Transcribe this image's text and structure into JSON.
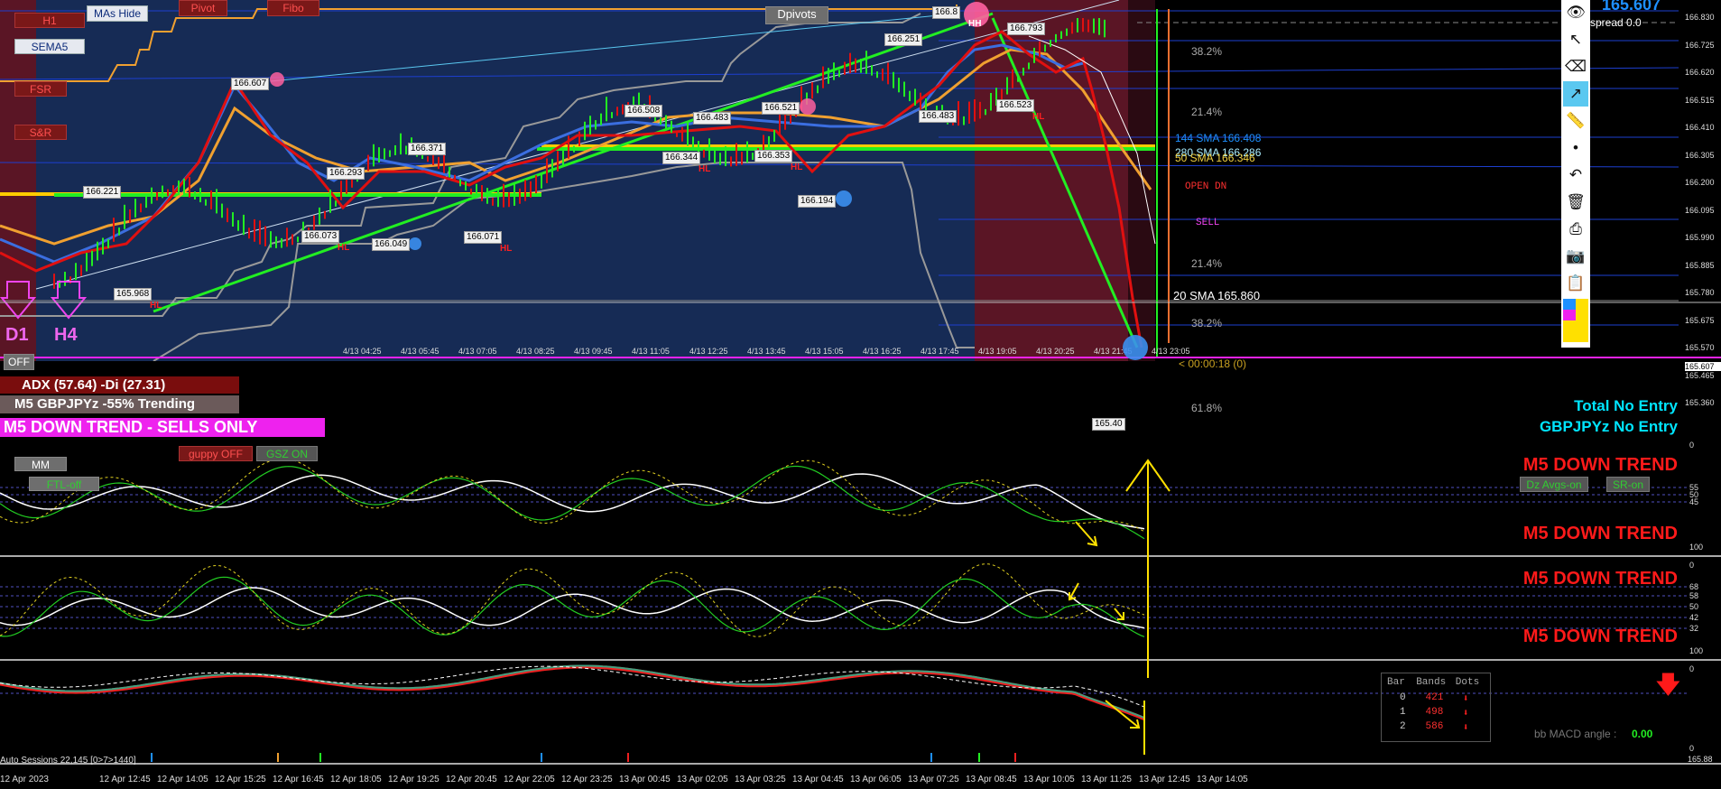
{
  "buttons": {
    "h1": "H1",
    "mas_hide": "MAs Hide",
    "pivot": "Pivot",
    "fibo": "Fibo",
    "sema5": "SEMA5",
    "fsr": "FSR",
    "snr": "S&R",
    "dpivots": "Dpivots",
    "off": "OFF",
    "mm": "MM",
    "ftl_off": "FTL-off",
    "guppy_off": "guppy OFF",
    "gsz_on": "GSZ ON",
    "dz_avgs_on": "Dz Avgs-on",
    "sr_on": "SR-on"
  },
  "timeframes": {
    "d1": "D1",
    "h4": "H4"
  },
  "status": {
    "adx": "ADX (57.64)  -Di (27.31)",
    "trending": "M5 GBPJPYz -55% Trending",
    "trend_banner": "M5  DOWN TREND - SELLS ONLY",
    "total_no_entry": "Total No Entry",
    "pair_no_entry": "GBPJPYz No Entry",
    "bid_price": "165.607",
    "spread": "spread 0.0",
    "open_dn": "OPEN DN",
    "sell": "SELL",
    "countdown": "< 00:00:18 (0)",
    "sma20": "20 SMA 165.860",
    "sma144": "144 SMA 166.408",
    "sma50": "50 SMA 166.346",
    "sma280": "280 SMA 166.286"
  },
  "fib_levels": [
    "38.2%",
    "21.4%",
    "21.4%",
    "38.2%",
    "61.8%"
  ],
  "swing_labels": [
    {
      "price": "166.607",
      "tag": ""
    },
    {
      "price": "166.221",
      "tag": ""
    },
    {
      "price": "165.968",
      "tag": "HL"
    },
    {
      "price": "166.371",
      "tag": ""
    },
    {
      "price": "166.293",
      "tag": ""
    },
    {
      "price": "166.073",
      "tag": "HL"
    },
    {
      "price": "166.049",
      "tag": ""
    },
    {
      "price": "166.071",
      "tag": "HL"
    },
    {
      "price": "166.508",
      "tag": ""
    },
    {
      "price": "166.483",
      "tag": ""
    },
    {
      "price": "166.344",
      "tag": "HL"
    },
    {
      "price": "166.521",
      "tag": ""
    },
    {
      "price": "166.353",
      "tag": "HL"
    },
    {
      "price": "166.194",
      "tag": ""
    },
    {
      "price": "166.251",
      "tag": ""
    },
    {
      "price": "166.483",
      "tag": ""
    },
    {
      "price": "166.8",
      "tag": "HH"
    },
    {
      "price": "166.793",
      "tag": ""
    },
    {
      "price": "166.523",
      "tag": "HL"
    },
    {
      "price": "165.40",
      "tag": ""
    }
  ],
  "price_axis": [
    "166.830",
    "166.725",
    "166.620",
    "166.515",
    "166.410",
    "166.305",
    "166.200",
    "166.095",
    "165.990",
    "165.885",
    "165.780",
    "165.675",
    "165.607",
    "165.570",
    "165.465",
    "165.360"
  ],
  "main_time_axis": [
    "4/13 04:25",
    "4/13 05:45",
    "4/13 07:05",
    "4/13 08:25",
    "4/13 09:45",
    "4/13 11:05",
    "4/13 12:25",
    "4/13 13:45",
    "4/13 15:05",
    "4/13 16:25",
    "4/13 17:45",
    "4/13 19:05",
    "4/13 20:25",
    "4/13 21:45",
    "4/13 23:05"
  ],
  "panels": {
    "p1_trend_top": "M5 DOWN TREND",
    "p1_trend_bottom": "M5 DOWN TREND",
    "p1_scale": [
      "0",
      "55",
      "50",
      "45",
      "100"
    ],
    "p2_trend_top": "M5 DOWN TREND",
    "p2_trend_bottom": "M5 DOWN TREND",
    "p2_scale": [
      "0",
      "68",
      "58",
      "50",
      "42",
      "32",
      "100"
    ],
    "p3_scale": [
      "0",
      "0"
    ],
    "bb_macd_label": "bb MACD angle :",
    "bb_macd_value": "0.00"
  },
  "bands_table": {
    "headers": [
      "Bar",
      "Bands",
      "Dots"
    ],
    "rows": [
      {
        "bar": "0",
        "bands": "421"
      },
      {
        "bar": "1",
        "bands": "498"
      },
      {
        "bar": "2",
        "bands": "586"
      }
    ]
  },
  "bottom_axis": {
    "sessions_label": "Auto Sessions 22,145 [0>7>1440]",
    "right_label": "165.88",
    "ticks": [
      "12 Apr 2023",
      "12 Apr 12:45",
      "12 Apr 14:05",
      "12 Apr 15:25",
      "12 Apr 16:45",
      "12 Apr 18:05",
      "12 Apr 19:25",
      "12 Apr 20:45",
      "12 Apr 22:05",
      "12 Apr 23:25",
      "13 Apr 00:45",
      "13 Apr 02:05",
      "13 Apr 03:25",
      "13 Apr 04:45",
      "13 Apr 06:05",
      "13 Apr 07:25",
      "13 Apr 08:45",
      "13 Apr 10:05",
      "13 Apr 11:25",
      "13 Apr 12:45",
      "13 Apr 14:05"
    ]
  },
  "toolbar": {
    "icons": [
      "eye-icon",
      "cursor-icon",
      "eraser-icon",
      "line-arrow-icon",
      "ruler-icon",
      "dot-icon",
      "undo-icon",
      "trash-icon",
      "printer-icon",
      "camera-icon",
      "clipboard-icon",
      "palette-icon"
    ]
  },
  "colors": {
    "main_bg": "#162b55",
    "session_red": "#5a1525",
    "uptrend_green": "#22ee22",
    "candle_red": "#e01010",
    "trend_magenta": "#ee22ee",
    "fast_ma": "#3b6ee0",
    "slow_ma": "#f0a030",
    "status_cyan": "#00e5ff",
    "down_red": "#ff1a1a",
    "yellow": "#ffe000"
  }
}
